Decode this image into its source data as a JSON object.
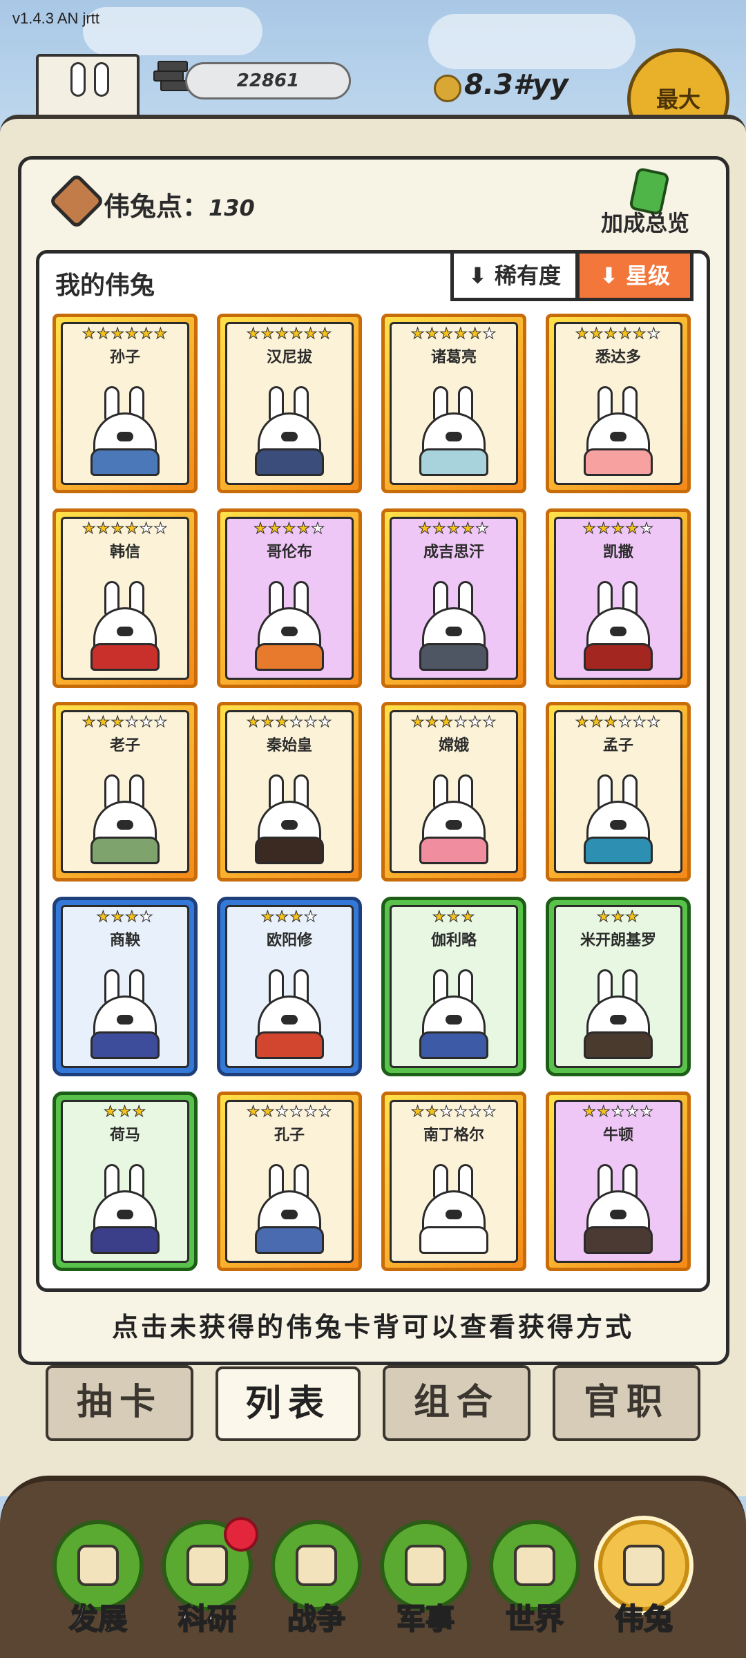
{
  "topbar": {
    "version": "v1.4.3 AN jrtt",
    "silver_value": "22861",
    "gold_value": "8.3#yy",
    "max_label": "最大"
  },
  "panel": {
    "points_label": "伟兔点：",
    "points_value": "130",
    "bonus_label": "加成总览",
    "my_label": "我的伟兔",
    "sort_rarity": "稀有度",
    "sort_star": "星级",
    "hint": "点击未获得的伟兔卡背可以查看获得方式"
  },
  "cards": [
    {
      "name": "孙子",
      "stars": 6,
      "max": 6,
      "frame": "gold",
      "bg": "cream",
      "robe": "#4b78b8"
    },
    {
      "name": "汉尼拔",
      "stars": 6,
      "max": 6,
      "frame": "gold",
      "bg": "cream",
      "robe": "#3b4d7a"
    },
    {
      "name": "诸葛亮",
      "stars": 5,
      "max": 6,
      "frame": "gold",
      "bg": "cream",
      "robe": "#a8d3dc"
    },
    {
      "name": "悉达多",
      "stars": 5,
      "max": 6,
      "frame": "gold",
      "bg": "cream",
      "robe": "#f7a1a1"
    },
    {
      "name": "韩信",
      "stars": 4,
      "max": 6,
      "frame": "gold",
      "bg": "cream",
      "robe": "#c9302c"
    },
    {
      "name": "哥伦布",
      "stars": 4,
      "max": 5,
      "frame": "gold",
      "bg": "purple",
      "robe": "#e77a2d"
    },
    {
      "name": "成吉思汗",
      "stars": 4,
      "max": 5,
      "frame": "gold",
      "bg": "purple",
      "robe": "#4e5563"
    },
    {
      "name": "凯撒",
      "stars": 4,
      "max": 5,
      "frame": "gold",
      "bg": "purple",
      "robe": "#a32620"
    },
    {
      "name": "老子",
      "stars": 3,
      "max": 6,
      "frame": "gold",
      "bg": "cream",
      "robe": "#7fa36c"
    },
    {
      "name": "秦始皇",
      "stars": 3,
      "max": 6,
      "frame": "gold",
      "bg": "cream",
      "robe": "#3b2a22"
    },
    {
      "name": "嫦娥",
      "stars": 3,
      "max": 6,
      "frame": "gold",
      "bg": "cream",
      "robe": "#f08ea0"
    },
    {
      "name": "孟子",
      "stars": 3,
      "max": 6,
      "frame": "gold",
      "bg": "cream",
      "robe": "#2d8fb1"
    },
    {
      "name": "商鞅",
      "stars": 3,
      "max": 4,
      "frame": "blue",
      "bg": "bluebg",
      "robe": "#3e4d9b"
    },
    {
      "name": "欧阳修",
      "stars": 3,
      "max": 4,
      "frame": "blue",
      "bg": "bluebg",
      "robe": "#d2452f"
    },
    {
      "name": "伽利略",
      "stars": 3,
      "max": 3,
      "frame": "green",
      "bg": "greenbg",
      "robe": "#3c5aa5"
    },
    {
      "name": "米开朗基罗",
      "stars": 3,
      "max": 3,
      "frame": "green",
      "bg": "greenbg",
      "robe": "#4a3a2e"
    },
    {
      "name": "荷马",
      "stars": 3,
      "max": 3,
      "frame": "green",
      "bg": "greenbg",
      "robe": "#3b3f8a"
    },
    {
      "name": "孔子",
      "stars": 2,
      "max": 6,
      "frame": "gold",
      "bg": "cream",
      "robe": "#4a6bb0"
    },
    {
      "name": "南丁格尔",
      "stars": 2,
      "max": 6,
      "frame": "gold",
      "bg": "cream",
      "robe": "#ffffff"
    },
    {
      "name": "牛顿",
      "stars": 2,
      "max": 5,
      "frame": "gold",
      "bg": "purple",
      "robe": "#4a3a33"
    }
  ],
  "tabs": [
    {
      "label": "抽卡",
      "active": false
    },
    {
      "label": "列表",
      "active": true
    },
    {
      "label": "组合",
      "active": false
    },
    {
      "label": "官职",
      "active": false
    }
  ],
  "nav": [
    {
      "label": "发展",
      "icon": "arrow-up-icon",
      "active": false
    },
    {
      "label": "科研",
      "icon": "flask-icon",
      "active": false,
      "badge": true
    },
    {
      "label": "战争",
      "icon": "swords-icon",
      "active": false
    },
    {
      "label": "军事",
      "icon": "helmet-icon",
      "active": false
    },
    {
      "label": "世界",
      "icon": "globe-icon",
      "active": false
    },
    {
      "label": "伟兔",
      "icon": "rabbit-card-icon",
      "active": true
    }
  ]
}
